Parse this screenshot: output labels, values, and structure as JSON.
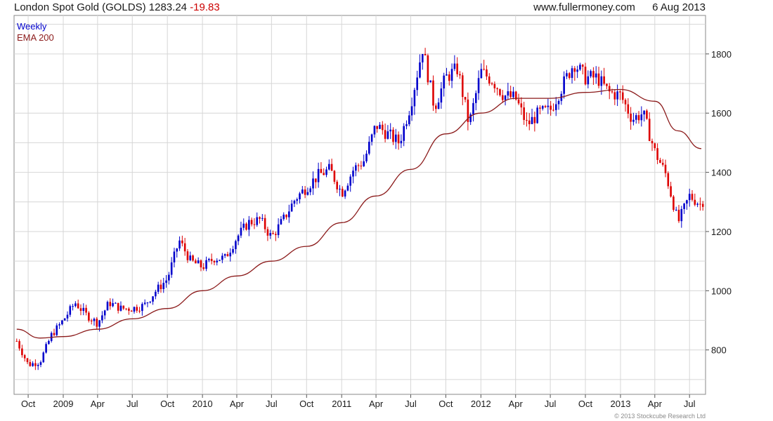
{
  "header": {
    "title": "London Spot Gold (GOLDS)",
    "price": "1283.24",
    "change": "-19.83",
    "site": "www.fullermoney.com",
    "date": "6 Aug 2013"
  },
  "copyright": "© 2013 Stockcube Research Ltd",
  "colors": {
    "up": "#0000cc",
    "down": "#dd0000",
    "ema": "#8b1a1a",
    "grid": "#d6d6d6"
  },
  "chart_data": {
    "type": "candlestick",
    "frequency": "Weekly",
    "legend": [
      "Weekly",
      "EMA 200"
    ],
    "legend_placement": "top-left",
    "grid": true,
    "ylim": [
      650,
      1930
    ],
    "y_ticks": [
      800,
      1000,
      1200,
      1400,
      1600,
      1800
    ],
    "x_ticks": [
      "Oct",
      "2009",
      "Apr",
      "Jul",
      "Oct",
      "2010",
      "Apr",
      "Jul",
      "Oct",
      "2011",
      "Apr",
      "Jul",
      "Oct",
      "2012",
      "Apr",
      "Jul",
      "Oct",
      "2013",
      "Apr",
      "Jul"
    ],
    "price_path": [
      [
        "2008-09",
        830
      ],
      [
        "2008-10",
        750
      ],
      [
        "2008-11",
        760
      ],
      [
        "2008-12",
        850
      ],
      [
        "2009-01",
        900
      ],
      [
        "2009-02",
        960
      ],
      [
        "2009-03",
        920
      ],
      [
        "2009-04",
        890
      ],
      [
        "2009-05",
        960
      ],
      [
        "2009-06",
        940
      ],
      [
        "2009-07",
        940
      ],
      [
        "2009-08",
        950
      ],
      [
        "2009-09",
        1000
      ],
      [
        "2009-10",
        1040
      ],
      [
        "2009-11",
        1170
      ],
      [
        "2009-12",
        1100
      ],
      [
        "2010-01",
        1080
      ],
      [
        "2010-02",
        1110
      ],
      [
        "2010-03",
        1110
      ],
      [
        "2010-04",
        1180
      ],
      [
        "2010-05",
        1230
      ],
      [
        "2010-06",
        1240
      ],
      [
        "2010-07",
        1180
      ],
      [
        "2010-08",
        1240
      ],
      [
        "2010-09",
        1310
      ],
      [
        "2010-10",
        1350
      ],
      [
        "2010-11",
        1390
      ],
      [
        "2010-12",
        1410
      ],
      [
        "2011-01",
        1330
      ],
      [
        "2011-02",
        1410
      ],
      [
        "2011-03",
        1440
      ],
      [
        "2011-04",
        1560
      ],
      [
        "2011-05",
        1530
      ],
      [
        "2011-06",
        1500
      ],
      [
        "2011-07",
        1630
      ],
      [
        "2011-08",
        1820
      ],
      [
        "2011-09",
        1620
      ],
      [
        "2011-10",
        1720
      ],
      [
        "2011-11",
        1750
      ],
      [
        "2011-12",
        1560
      ],
      [
        "2012-01",
        1740
      ],
      [
        "2012-02",
        1710
      ],
      [
        "2012-03",
        1660
      ],
      [
        "2012-04",
        1650
      ],
      [
        "2012-05",
        1560
      ],
      [
        "2012-06",
        1600
      ],
      [
        "2012-07",
        1610
      ],
      [
        "2012-08",
        1690
      ],
      [
        "2012-09",
        1770
      ],
      [
        "2012-10",
        1720
      ],
      [
        "2012-11",
        1720
      ],
      [
        "2012-12",
        1670
      ],
      [
        "2013-01",
        1660
      ],
      [
        "2013-02",
        1580
      ],
      [
        "2013-03",
        1600
      ],
      [
        "2013-04",
        1470
      ],
      [
        "2013-05",
        1390
      ],
      [
        "2013-06",
        1230
      ],
      [
        "2013-07",
        1320
      ],
      [
        "2013-08",
        1290
      ]
    ],
    "ema_200_path": [
      [
        "2008-09",
        870
      ],
      [
        "2008-11",
        840
      ],
      [
        "2009-01",
        845
      ],
      [
        "2009-04",
        870
      ],
      [
        "2009-07",
        905
      ],
      [
        "2009-10",
        940
      ],
      [
        "2010-01",
        1000
      ],
      [
        "2010-04",
        1050
      ],
      [
        "2010-07",
        1100
      ],
      [
        "2010-10",
        1150
      ],
      [
        "2011-01",
        1230
      ],
      [
        "2011-04",
        1320
      ],
      [
        "2011-07",
        1410
      ],
      [
        "2011-10",
        1530
      ],
      [
        "2012-01",
        1600
      ],
      [
        "2012-04",
        1650
      ],
      [
        "2012-07",
        1650
      ],
      [
        "2012-10",
        1670
      ],
      [
        "2013-01",
        1680
      ],
      [
        "2013-04",
        1640
      ],
      [
        "2013-06",
        1540
      ],
      [
        "2013-08",
        1480
      ]
    ]
  }
}
